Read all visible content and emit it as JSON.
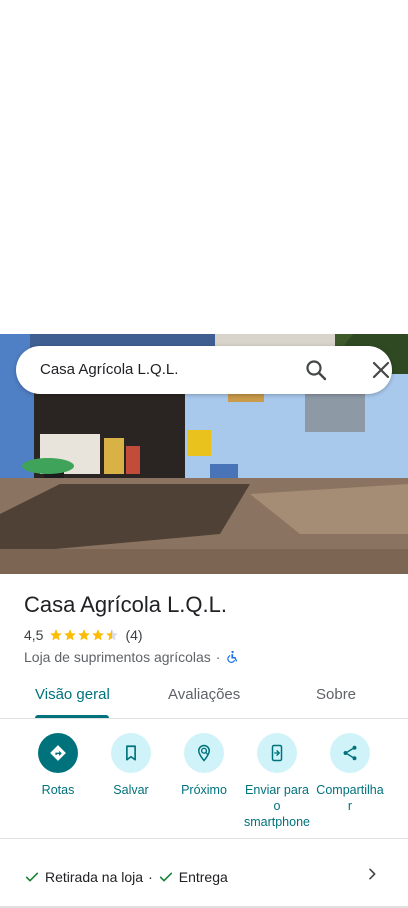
{
  "search": {
    "query": "Casa Agrícola L.Q.L."
  },
  "place": {
    "name": "Casa Agrícola L.Q.L.",
    "rating": "4,5",
    "rating_stars": 4.5,
    "review_count": "(4)",
    "category": "Loja de suprimentos agrícolas",
    "separator": "·"
  },
  "tabs": [
    {
      "label": "Visão geral",
      "active": true
    },
    {
      "label": "Avaliações",
      "active": false
    },
    {
      "label": "Sobre",
      "active": false
    }
  ],
  "actions": [
    {
      "label": "Rotas",
      "icon": "directions-icon"
    },
    {
      "label": "Salvar",
      "icon": "bookmark-icon"
    },
    {
      "label": "Próximo",
      "icon": "nearby-icon"
    },
    {
      "label_lines": [
        "Enviar para",
        "o",
        "smartphone"
      ],
      "icon": "send-to-phone-icon"
    },
    {
      "label_lines": [
        "Compartilha",
        "r"
      ],
      "icon": "share-icon"
    }
  ],
  "services": [
    {
      "label": "Retirada na loja"
    },
    {
      "label": "Entrega"
    }
  ],
  "colors": {
    "accent": "#00727c",
    "accent_light": "#d0f3f9",
    "star": "#fbbc04",
    "check": "#188038"
  }
}
